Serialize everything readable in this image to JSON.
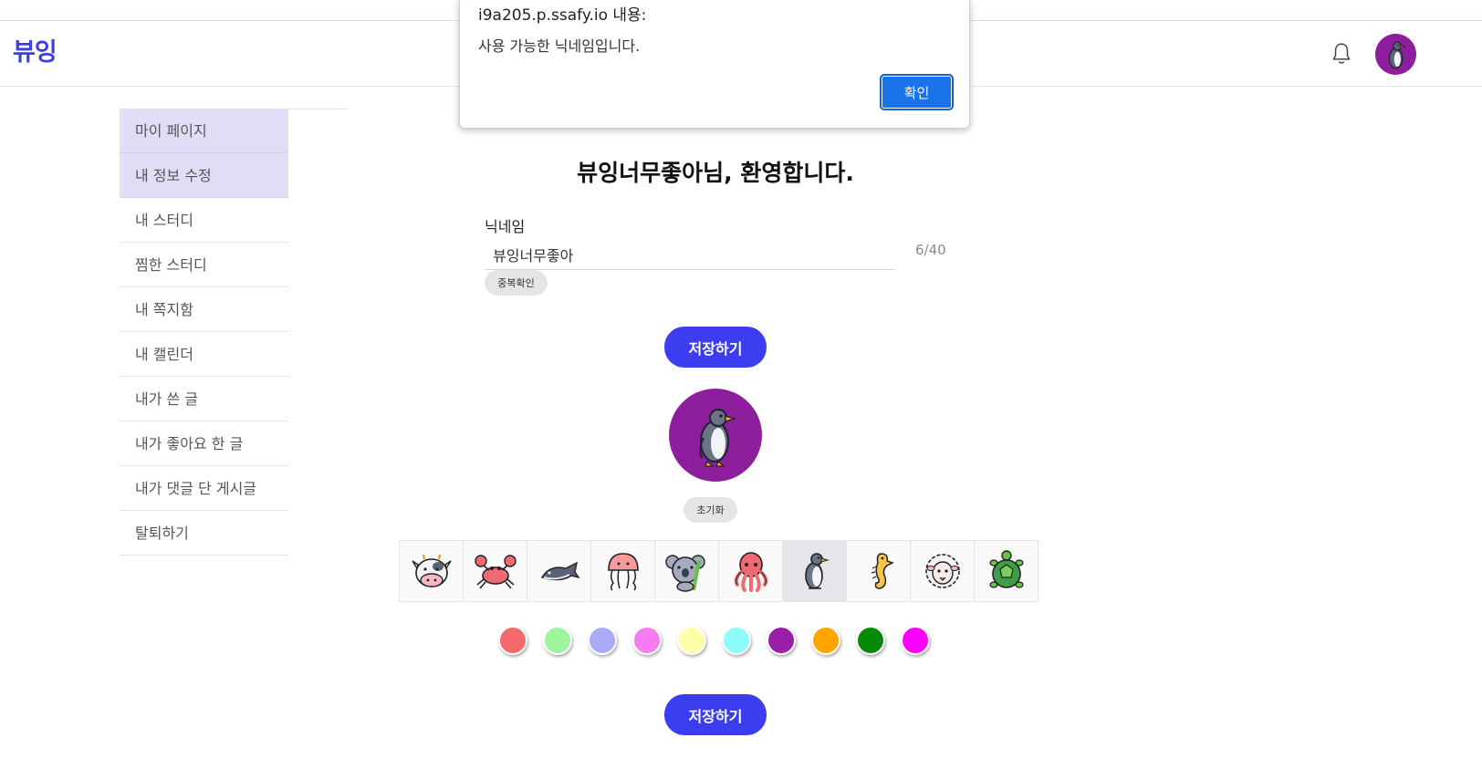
{
  "header": {
    "logo": "뷰잉",
    "icons": {
      "notifications": "bell-icon",
      "profile": "penguin-avatar-icon"
    },
    "avatar_bg": "#8e1f9c"
  },
  "sidebar": {
    "items": [
      {
        "label": "마이 페이지",
        "active": true
      },
      {
        "label": "내 정보 수정",
        "active": true
      },
      {
        "label": "내 스터디"
      },
      {
        "label": "찜한 스터디"
      },
      {
        "label": "내 쪽지함"
      },
      {
        "label": "내 캘린더"
      },
      {
        "label": "내가 쓴 글"
      },
      {
        "label": "내가 좋아요 한 글"
      },
      {
        "label": "내가 댓글 단 게시글"
      },
      {
        "label": "탈퇴하기"
      }
    ]
  },
  "main": {
    "welcome": "뷰잉너무좋아님, 환영합니다.",
    "nickname": {
      "label": "닉네임",
      "value": "뷰잉너무좋아",
      "count": "6/40",
      "check_button": "중복확인"
    },
    "save_button": "저장하기",
    "reset_button": "초기화",
    "selected_animal": "penguin",
    "animals": [
      "cow",
      "crab",
      "whale",
      "jellyfish",
      "koala",
      "octopus",
      "penguin",
      "seahorse",
      "sheep",
      "turtle"
    ],
    "colors": [
      "#f46a6a",
      "#9ef59e",
      "#aaaaf6",
      "#f77cf2",
      "#ffffaa",
      "#8ffcfc",
      "#9c1fa8",
      "#ffa500",
      "#078a07",
      "#ff00ff"
    ],
    "selected_color": "#9c1fa8"
  },
  "dialog": {
    "title": "i9a205.p.ssafy.io 내용:",
    "message": "사용 가능한 닉네임입니다.",
    "ok_button": "확인"
  }
}
